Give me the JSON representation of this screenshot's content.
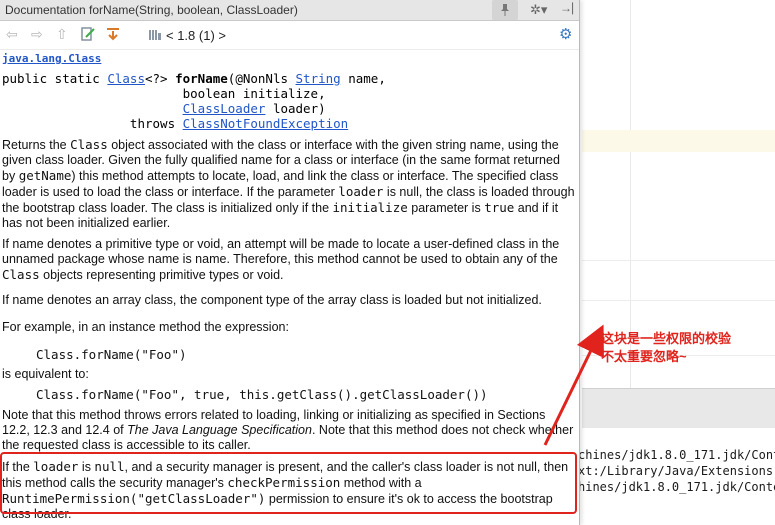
{
  "popup": {
    "title": "Documentation forName(String, boolean, ClassLoader)",
    "version": "< 1.8 (1) >",
    "package": "java.lang.Class",
    "signature": {
      "l1_pre": "public static ",
      "l1_class": "Class",
      "l1_mid": "<?> ",
      "l1_name": "forName",
      "l1_post1": "(@NonNls ",
      "l1_string": "String",
      "l1_post2": " name,",
      "l2": "                        boolean initialize,",
      "l3_indent": "                        ",
      "l3_cl": "ClassLoader",
      "l3_post": " loader)",
      "l4_pre": "                 throws ",
      "l4_ex": "ClassNotFoundException"
    },
    "para1": {
      "a": "Returns the ",
      "b": "Class",
      "c": " object associated with the class or interface with the given string name, using the given class loader. Given the fully qualified name for a class or interface (in the same format returned by ",
      "d": "getName",
      "e": ") this method attempts to locate, load, and link the class or interface. The specified class loader is used to load the class or interface. If the parameter ",
      "f": "loader",
      "g": " is null, the class is loaded through the bootstrap class loader. The class is initialized only if the ",
      "h": "initialize",
      "i": " parameter is ",
      "j": "true",
      "k": " and if it has not been initialized earlier."
    },
    "para2": {
      "a": "If name denotes a primitive type or void, an attempt will be made to locate a user-defined class in the unnamed package whose name is name. Therefore, this method cannot be used to obtain any of the ",
      "b": "Class",
      "c": " objects representing primitive types or void."
    },
    "para3": "If name denotes an array class, the component type of the array class is loaded but not initialized.",
    "para4": "For example, in an instance method the expression:",
    "code1": "Class.forName(\"Foo\")",
    "equivalent": "is equivalent to:",
    "code2": "Class.forName(\"Foo\", true, this.getClass().getClassLoader())",
    "para5": {
      "a": "Note that this method throws errors related to loading, linking or initializing as specified in Sections 12.2, 12.3 and 12.4 of ",
      "b": "The Java Language Specification",
      "c": ". Note that this method does not check whether the requested class is accessible to its caller."
    },
    "para6": {
      "a": "If the ",
      "b": "loader",
      "c": " is ",
      "d": "null",
      "e": ", and a security manager is present, and the caller's class loader is not null, then this method calls the security manager's ",
      "f": "checkPermission",
      "g": " method with a ",
      "h": "RuntimePermission(\"getClassLoader\")",
      "i": " permission to ensure it's ok to access the bootstrap class loader."
    }
  },
  "annotation": {
    "line1": "这块是一些权限的校验",
    "line2": "不太重要忽略~",
    "color": "#e0241d"
  },
  "console": {
    "lines": [
      "chines/jdk1.8.0_171.jdk/Cont",
      "xt:/Library/Java/Extensions:",
      "hines/jdk1.8.0_171.jdk/Conte"
    ]
  },
  "icons": [
    "back-arrow-icon",
    "forward-arrow-icon",
    "up-arrow-icon",
    "edit-source-icon",
    "jump-to-source-icon",
    "library-icon",
    "pin-icon",
    "gear-icon",
    "hide-icon",
    "settings-icon"
  ]
}
